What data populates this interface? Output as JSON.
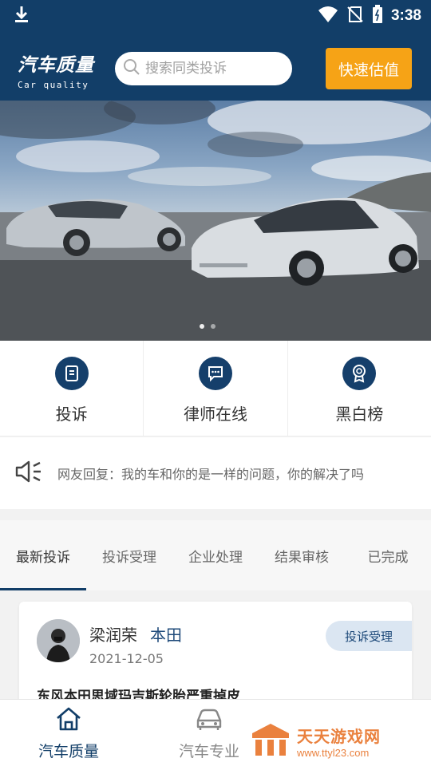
{
  "status_bar": {
    "time": "3:38"
  },
  "header": {
    "logo_cn": "汽车质量",
    "logo_en": "Car quality",
    "search_placeholder": "搜索同类投诉",
    "quick_button": "快速估值"
  },
  "banner": {
    "slide_count": 2,
    "active_slide": 1
  },
  "menu": [
    {
      "label": "投诉",
      "icon": "document-icon"
    },
    {
      "label": "律师在线",
      "icon": "chat-icon"
    },
    {
      "label": "黑白榜",
      "icon": "medal-icon"
    }
  ],
  "notice": {
    "text": "网友回复：我的车和你的是一样的问题，你的解决了吗"
  },
  "tabs": [
    {
      "label": "最新投诉",
      "active": true
    },
    {
      "label": "投诉受理",
      "active": false
    },
    {
      "label": "企业处理",
      "active": false
    },
    {
      "label": "结果审核",
      "active": false
    },
    {
      "label": "已完成",
      "active": false
    }
  ],
  "complaint": {
    "user": "梁润荣",
    "brand": "本田",
    "date": "2021-12-05",
    "status": "投诉受理",
    "title": "东风本田思域玛吉斯轮胎严重掉皮"
  },
  "bottom_nav": [
    {
      "label": "汽车质量",
      "icon": "home-icon",
      "active": true,
      "color": "#123e68"
    },
    {
      "label": "汽车专业",
      "icon": "car-icon",
      "active": false,
      "color": "#888888"
    }
  ],
  "watermark": {
    "cn": "天天游戏网",
    "en": "www.ttyl23.com"
  },
  "colors": {
    "primary": "#123e68",
    "accent": "#f6a316"
  }
}
